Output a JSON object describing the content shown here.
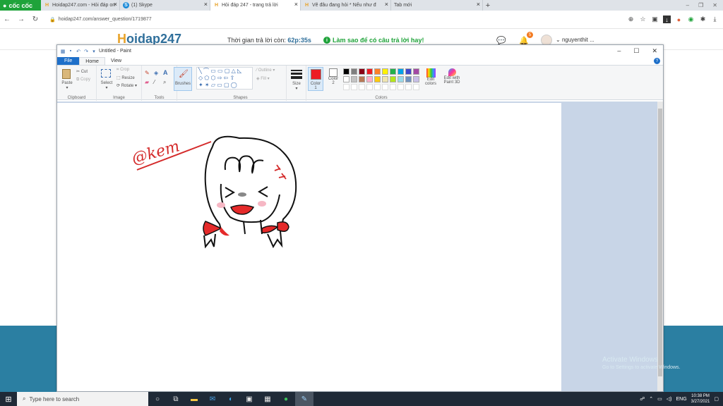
{
  "browser": {
    "logo_label": "cốc cốc",
    "tabs": [
      {
        "title": "Hoidap247.com - Hỏi đáp on",
        "favicon": "hoidap-favicon"
      },
      {
        "title": "(1) Skype",
        "favicon": "skype-favicon"
      },
      {
        "title": "Hỏi đáp 247 - trang trả lời",
        "favicon": "hoidap-favicon"
      },
      {
        "title": "Vẽ đâu đang hỏi * Nếu như đ",
        "favicon": "hoidap-favicon"
      },
      {
        "title": "Tab mới",
        "favicon": ""
      }
    ],
    "url": "hoidap247.com/answer_question/1719877"
  },
  "site": {
    "brand_prefix": "H",
    "brand_rest": "oidap247",
    "timer_label": "Thời gian trả lời còn:",
    "timer_value": "62p:35s",
    "howto_label": "Làm sao để có câu trả lời hay!",
    "notification_count": "5",
    "username": "nguyenthit ..."
  },
  "paint": {
    "title": "Untitled - Paint",
    "tabs": {
      "file": "File",
      "home": "Home",
      "view": "View"
    },
    "clipboard": {
      "paste": "Paste",
      "cut": "Cut",
      "copy": "Copy",
      "group": "Clipboard"
    },
    "image": {
      "select": "Select",
      "crop": "Crop",
      "resize": "Resize",
      "rotate": "Rotate",
      "group": "Image"
    },
    "tools": {
      "group": "Tools"
    },
    "brushes": "Brushes",
    "shapes": {
      "outline": "Outline",
      "fill": "Fill",
      "group": "Shapes"
    },
    "size": "Size",
    "color1": {
      "line1": "Color",
      "line2": "1"
    },
    "color2": {
      "line1": "Color",
      "line2": "2"
    },
    "colors_group": "Colors",
    "edit_colors": {
      "line1": "Edit",
      "line2": "colors"
    },
    "paint3d": {
      "line1": "Edit with",
      "line2": "Paint 3D"
    },
    "palette": [
      "#000000",
      "#7f7f7f",
      "#880015",
      "#ed1c24",
      "#ff7f27",
      "#fff200",
      "#22b14c",
      "#00a2e8",
      "#3f48cc",
      "#a349a4",
      "#ffffff",
      "#c3c3c3",
      "#b97a57",
      "#ffaec9",
      "#ffc90e",
      "#efe4b0",
      "#b5e61d",
      "#99d9ea",
      "#7092be",
      "#c8bfe7"
    ],
    "active_color": "#ed1c24",
    "drawing_text": "@kem"
  },
  "overlay": {
    "activate_title": "Activate Windows",
    "activate_sub": "Go to Settings to activate Windows."
  },
  "taskbar": {
    "search_placeholder": "Type here to search",
    "language": "ENG",
    "time": "10:38 PM",
    "date": "3/27/2021"
  }
}
